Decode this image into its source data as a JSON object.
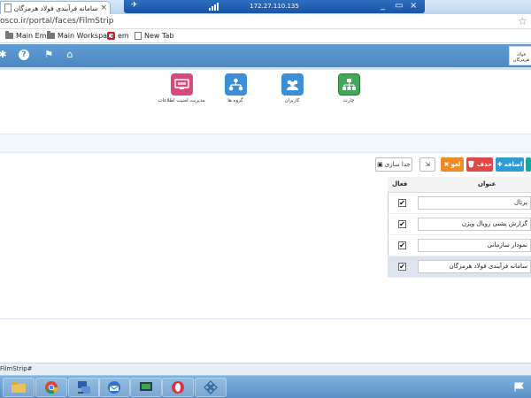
{
  "browser": {
    "tab_title": "سامانه فرآیندی فولاد هرمزگان",
    "tab_close": "×",
    "rdp_ip": "172.27.110.135",
    "rdp_controls": {
      "minimize": "_",
      "restore": "▭",
      "close": "×"
    },
    "address": "osco.ir/portal/faces/FilmStrip",
    "bookmarks": [
      {
        "label": "Main Em",
        "icon": "folder-icon"
      },
      {
        "label": "Main Workspace",
        "icon": "folder-icon"
      },
      {
        "label": "em",
        "icon": "oracle-icon"
      },
      {
        "label": "New Tab",
        "icon": "page-icon"
      }
    ]
  },
  "app": {
    "logo_text": "فولاد هرمزگان",
    "toolbar_icons": [
      "gear-icon",
      "help-icon",
      "flag-icon",
      "home-icon"
    ],
    "menu": [
      {
        "label": "مدیریت امنیت اطلاعات",
        "icon": "monitor-icon",
        "color": "#d64b7b"
      },
      {
        "label": "گروه ها",
        "icon": "group-tree-icon",
        "color": "#3c8fd6"
      },
      {
        "label": "کاربران",
        "icon": "users-icon",
        "color": "#3c8fd6"
      },
      {
        "label": "چارت",
        "icon": "org-chart-icon",
        "color": "#41a85a"
      }
    ],
    "actions": {
      "detach": "جدا سازی",
      "cancel": "لغو",
      "delete": "حذف",
      "add": "اضافه"
    },
    "grid": {
      "col_active": "فعال",
      "col_title": "عنوان",
      "rows": [
        {
          "title": "پرتال",
          "active": true
        },
        {
          "title": "گزارش پشتی رویال ویژن",
          "active": true
        },
        {
          "title": "نمودار سازمانی",
          "active": true
        },
        {
          "title": "سامانه فرآیندی فولاد هرمزگان",
          "active": true,
          "selected": true
        }
      ]
    },
    "status_text": "FilmStrip#"
  },
  "colors": {
    "toolbar": "#4d88c4",
    "btn_delete": "#e04848",
    "btn_cancel": "#f08a24",
    "btn_add": "#2e9bd6",
    "btn_teal": "#19a6a0"
  },
  "taskbar": [
    "explorer-icon",
    "chrome-icon",
    "network-icon",
    "thunderbird-icon",
    "remote-icon",
    "opera-icon",
    "diamond-grid-icon"
  ]
}
